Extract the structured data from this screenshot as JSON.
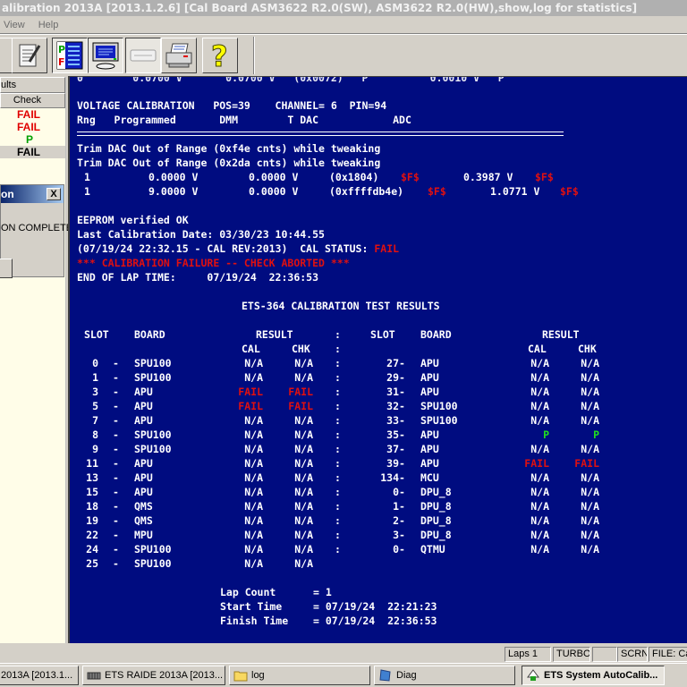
{
  "window": {
    "title": "alibration 2013A [2013.1.2.6]  [Cal Board ASM3622 R2.0(SW), ASM3622 R2.0(HW),show,log for statistics]"
  },
  "menu": {
    "items": [
      "View",
      "Help"
    ]
  },
  "toolbar": {
    "buttons": [
      {
        "name": "edit-notes",
        "icon": "notepad-pencil-icon"
      },
      {
        "name": "pass-fail-report",
        "icon": "pf-report-icon",
        "pressed": true
      },
      {
        "name": "monitor",
        "icon": "monitor-icon",
        "pressed": true
      },
      {
        "name": "device",
        "icon": "scanner-icon",
        "pressed": true
      },
      {
        "name": "print",
        "icon": "printer-icon"
      },
      {
        "name": "help",
        "icon": "question-mark-icon"
      }
    ]
  },
  "left_panel": {
    "header": "ults",
    "column": "Check",
    "rows": [
      {
        "value": "FAIL",
        "status": "fail"
      },
      {
        "value": "FAIL",
        "status": "fail"
      },
      {
        "value": "P",
        "status": "pass"
      },
      {
        "value": "FAIL",
        "status": "selected"
      }
    ]
  },
  "dialog": {
    "title": "on",
    "message": "ON COMPLETE",
    "close_label": "X"
  },
  "console": {
    "partial_top": "0        0.0700 V       0.0700 V   (0x0072)   P          0.0010 V   P",
    "voltage_cal_header": "VOLTAGE CALIBRATION   POS=39    CHANNEL= 6  PIN=94",
    "columns_header": "Rng   Programmed       DMM        T DAC            ADC",
    "trim_lines": [
      "Trim DAC Out of Range (0xf4e cnts) while tweaking",
      "Trim DAC Out of Range (0x2da cnts) while tweaking"
    ],
    "cal_rows": [
      {
        "rng": "1",
        "programmed": "0.0000 V",
        "dmm": "0.0000 V",
        "tdac": "(0x1804)",
        "flag1": "$F$",
        "adc": "0.3987 V",
        "flag2": "$F$"
      },
      {
        "rng": "1",
        "programmed": "9.0000 V",
        "dmm": "0.0000 V",
        "tdac": "(0xffffdb4e)",
        "flag1": "$F$",
        "adc": "1.0771 V",
        "flag2": "$F$"
      }
    ],
    "eeprom": "EEPROM verified OK",
    "last_cal_date": "Last Calibration Date: 03/30/23 10:44.55",
    "cal_status_prefix": "(07/19/24 22:32.15 - CAL REV:2013)  CAL STATUS: ",
    "cal_status_value": "FAIL",
    "failure_msg": "*** CALIBRATION FAILURE -- CHECK ABORTED ***",
    "end_of_lap": "END OF LAP TIME:     07/19/24  22:36:53",
    "results_title": "ETS-364 CALIBRATION TEST RESULTS",
    "results_headers": {
      "slot": "SLOT",
      "board": "BOARD",
      "result": "RESULT",
      "cal": "CAL",
      "chk": "CHK",
      "sep": ":"
    },
    "results_left": [
      {
        "slot": "0",
        "board": "SPU100",
        "cal": "N/A",
        "chk": "N/A"
      },
      {
        "slot": "1",
        "board": "SPU100",
        "cal": "N/A",
        "chk": "N/A"
      },
      {
        "slot": "3",
        "board": "APU",
        "cal": "FAIL",
        "chk": "FAIL"
      },
      {
        "slot": "5",
        "board": "APU",
        "cal": "FAIL",
        "chk": "FAIL"
      },
      {
        "slot": "7",
        "board": "APU",
        "cal": "N/A",
        "chk": "N/A"
      },
      {
        "slot": "8",
        "board": "SPU100",
        "cal": "N/A",
        "chk": "N/A"
      },
      {
        "slot": "9",
        "board": "SPU100",
        "cal": "N/A",
        "chk": "N/A"
      },
      {
        "slot": "11",
        "board": "APU",
        "cal": "N/A",
        "chk": "N/A"
      },
      {
        "slot": "13",
        "board": "APU",
        "cal": "N/A",
        "chk": "N/A"
      },
      {
        "slot": "15",
        "board": "APU",
        "cal": "N/A",
        "chk": "N/A"
      },
      {
        "slot": "18",
        "board": "QMS",
        "cal": "N/A",
        "chk": "N/A"
      },
      {
        "slot": "19",
        "board": "QMS",
        "cal": "N/A",
        "chk": "N/A"
      },
      {
        "slot": "22",
        "board": "MPU",
        "cal": "N/A",
        "chk": "N/A"
      },
      {
        "slot": "24",
        "board": "SPU100",
        "cal": "N/A",
        "chk": "N/A"
      },
      {
        "slot": "25",
        "board": "SPU100",
        "cal": "N/A",
        "chk": "N/A"
      }
    ],
    "results_right": [
      {
        "slot": "27",
        "board": "APU",
        "cal": "N/A",
        "chk": "N/A"
      },
      {
        "slot": "29",
        "board": "APU",
        "cal": "N/A",
        "chk": "N/A"
      },
      {
        "slot": "31",
        "board": "APU",
        "cal": "N/A",
        "chk": "N/A"
      },
      {
        "slot": "32",
        "board": "SPU100",
        "cal": "N/A",
        "chk": "N/A"
      },
      {
        "slot": "33",
        "board": "SPU100",
        "cal": "N/A",
        "chk": "N/A"
      },
      {
        "slot": "35",
        "board": "APU",
        "cal": "P",
        "chk": "P"
      },
      {
        "slot": "37",
        "board": "APU",
        "cal": "N/A",
        "chk": "N/A"
      },
      {
        "slot": "39",
        "board": "APU",
        "cal": "FAIL",
        "chk": "FAIL"
      },
      {
        "slot": "134",
        "board": "MCU",
        "cal": "N/A",
        "chk": "N/A"
      },
      {
        "slot": "0",
        "board": "DPU_8",
        "cal": "N/A",
        "chk": "N/A"
      },
      {
        "slot": "1",
        "board": "DPU_8",
        "cal": "N/A",
        "chk": "N/A"
      },
      {
        "slot": "2",
        "board": "DPU_8",
        "cal": "N/A",
        "chk": "N/A"
      },
      {
        "slot": "3",
        "board": "DPU_8",
        "cal": "N/A",
        "chk": "N/A"
      },
      {
        "slot": "0",
        "board": "QTMU",
        "cal": "N/A",
        "chk": "N/A"
      }
    ],
    "summary": [
      {
        "label": "Lap Count",
        "value": "= 1"
      },
      {
        "label": "Start Time",
        "value": "= 07/19/24  22:21:23"
      },
      {
        "label": "Finish Time",
        "value": "= 07/19/24  22:36:53"
      }
    ]
  },
  "statusbar": {
    "laps": "Laps 1",
    "turbo": "TURBO",
    "blank": "",
    "scrn": "SCRN",
    "file": "FILE: Ca"
  },
  "taskbar": {
    "items": [
      {
        "label": "2013A [2013.1...",
        "icon": "app-icon"
      },
      {
        "label": "ETS RAIDE 2013A [2013...",
        "icon": "raide-icon"
      },
      {
        "label": "log",
        "icon": "folder-icon"
      },
      {
        "label": "Diag",
        "icon": "document-icon"
      },
      {
        "label": "ETS System AutoCalib...",
        "icon": "autocalib-icon",
        "active": true
      }
    ]
  },
  "colors": {
    "console_bg": "#000c80",
    "fail": "#e01010",
    "pass": "#20e020",
    "text": "#ffffff"
  }
}
